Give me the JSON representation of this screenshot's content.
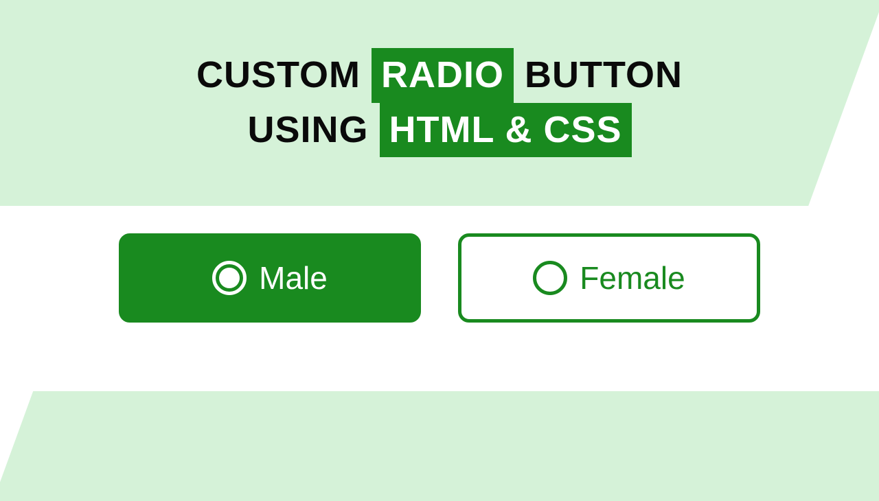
{
  "heading": {
    "line1_pre": "CUSTOM ",
    "line1_highlight": "RADIO",
    "line1_post": " BUTTON",
    "line2_pre": "USING ",
    "line2_highlight": "HTML & CSS"
  },
  "options": {
    "male": {
      "label": "Male",
      "selected": true
    },
    "female": {
      "label": "Female",
      "selected": false
    }
  },
  "colors": {
    "accent": "#198a1f",
    "bg_tint": "#d5f2d8"
  }
}
